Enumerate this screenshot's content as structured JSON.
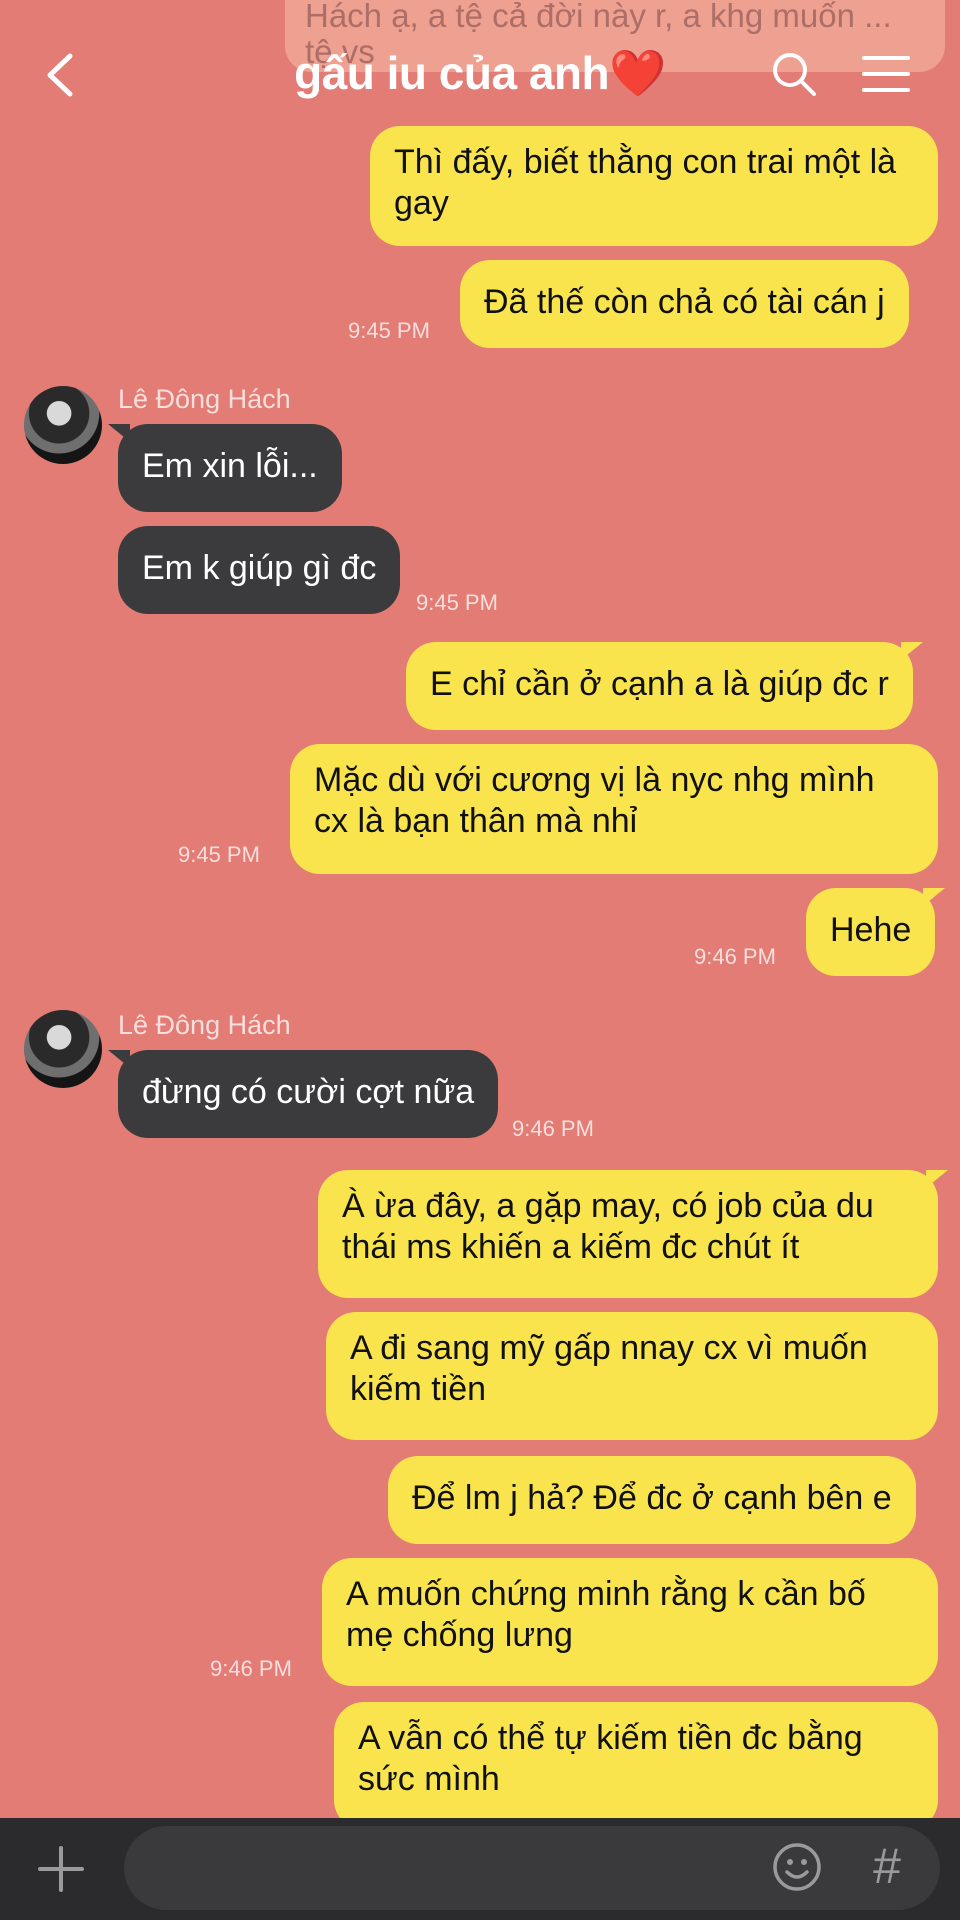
{
  "header": {
    "title": "gấu iu của anh❤️",
    "back_icon": "chevron-left-icon",
    "search_icon": "search-icon",
    "menu_icon": "hamburger-menu-icon"
  },
  "faded_banner": {
    "text": "Hách ạ, a tệ cả đời này r, a khg muốn ... tệ vs"
  },
  "messages": [
    {
      "side": "me",
      "text": "Thì đấy, biết thằng con trai một là gay",
      "time": ""
    },
    {
      "side": "me",
      "text": "Đã thế còn chả có tài cán j",
      "time": "9:45 PM"
    },
    {
      "side": "them",
      "sender": "Lê Đông Hách",
      "text": "Em xin lỗi...",
      "time": ""
    },
    {
      "side": "them",
      "text": "Em k giúp gì đc",
      "time": "9:45 PM"
    },
    {
      "side": "me",
      "text": "E chỉ cần ở cạnh a là giúp đc r",
      "time": ""
    },
    {
      "side": "me",
      "text": "Mặc dù với cương vị là nyc nhg mình cx là bạn thân mà nhỉ",
      "time": "9:45 PM"
    },
    {
      "side": "me",
      "text": "Hehe",
      "time": "9:46 PM"
    },
    {
      "side": "them",
      "sender": "Lê Đông Hách",
      "text": "đừng có cười cợt nữa",
      "time": "9:46 PM"
    },
    {
      "side": "me",
      "text": "À ừa đây, a gặp may, có job của du thái ms khiến a kiếm đc chút ít",
      "time": ""
    },
    {
      "side": "me",
      "text": "A đi sang mỹ gấp nnay cx vì muốn kiếm tiền",
      "time": ""
    },
    {
      "side": "me",
      "text": "Để lm j hả? Để đc ở cạnh bên e",
      "time": ""
    },
    {
      "side": "me",
      "text": "A muốn chứng minh rằng k cần bố mẹ chống lưng",
      "time": "9:46 PM"
    },
    {
      "side": "me",
      "text": "A vẫn có thể tự kiếm tiền đc bằng sức mình",
      "time": ""
    }
  ],
  "composer": {
    "plus_icon": "plus-icon",
    "emoji_icon": "emoji-icon",
    "hash_label": "#"
  },
  "colors": {
    "background": "#e27c74",
    "my_bubble": "#f9e44e",
    "their_bubble": "#3b3b3d",
    "bottom_bar": "#2b2b2d"
  }
}
